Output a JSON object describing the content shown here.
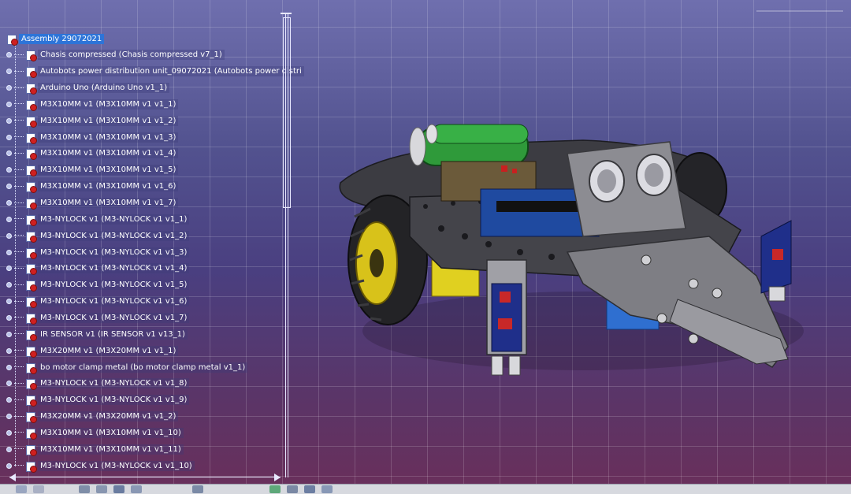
{
  "tree": {
    "nodes": [
      "Assembly 29072021",
      "Chasis compressed (Chasis compressed v7_1)",
      "Autobots power distribution unit_09072021 (Autobots power distri",
      "Arduino Uno (Arduino Uno v1_1)",
      "M3X10MM v1 (M3X10MM v1 v1_1)",
      "M3X10MM v1 (M3X10MM v1 v1_2)",
      "M3X10MM v1 (M3X10MM v1 v1_3)",
      "M3X10MM v1 (M3X10MM v1 v1_4)",
      "M3X10MM v1 (M3X10MM v1 v1_5)",
      "M3X10MM v1 (M3X10MM v1 v1_6)",
      "M3X10MM v1 (M3X10MM v1 v1_7)",
      "M3-NYLOCK v1 (M3-NYLOCK v1 v1_1)",
      "M3-NYLOCK v1 (M3-NYLOCK v1 v1_2)",
      "M3-NYLOCK v1 (M3-NYLOCK v1 v1_3)",
      "M3-NYLOCK v1 (M3-NYLOCK v1 v1_4)",
      "M3-NYLOCK v1 (M3-NYLOCK v1 v1_5)",
      "M3-NYLOCK v1 (M3-NYLOCK v1 v1_6)",
      "M3-NYLOCK v1 (M3-NYLOCK v1 v1_7)",
      "IR SENSOR v1 (IR SENSOR v1 v13_1)",
      "M3X20MM v1 (M3X20MM v1 v1_1)",
      "bo motor clamp metal (bo motor clamp metal v1_1)",
      "M3-NYLOCK v1 (M3-NYLOCK v1 v1_8)",
      "M3-NYLOCK v1 (M3-NYLOCK v1 v1_9)",
      "M3X20MM v1 (M3X20MM v1 v1_2)",
      "M3X10MM v1 (M3X10MM v1 v1_10)",
      "M3X10MM v1 (M3X10MM v1 v1_11)",
      "M3-NYLOCK v1 (M3-NYLOCK v1 v1_10)"
    ]
  },
  "colors": {
    "selection": "#2d74d8",
    "chassis": "#3a3a40",
    "battery": "#2f9a3a",
    "tire": "#232326",
    "hub": "#e8d21a",
    "sensor_board": "#1f2f8a",
    "bracket": "#8c8c92"
  },
  "icons": {
    "part": "part-product-icon",
    "compass": "compass-icon"
  }
}
